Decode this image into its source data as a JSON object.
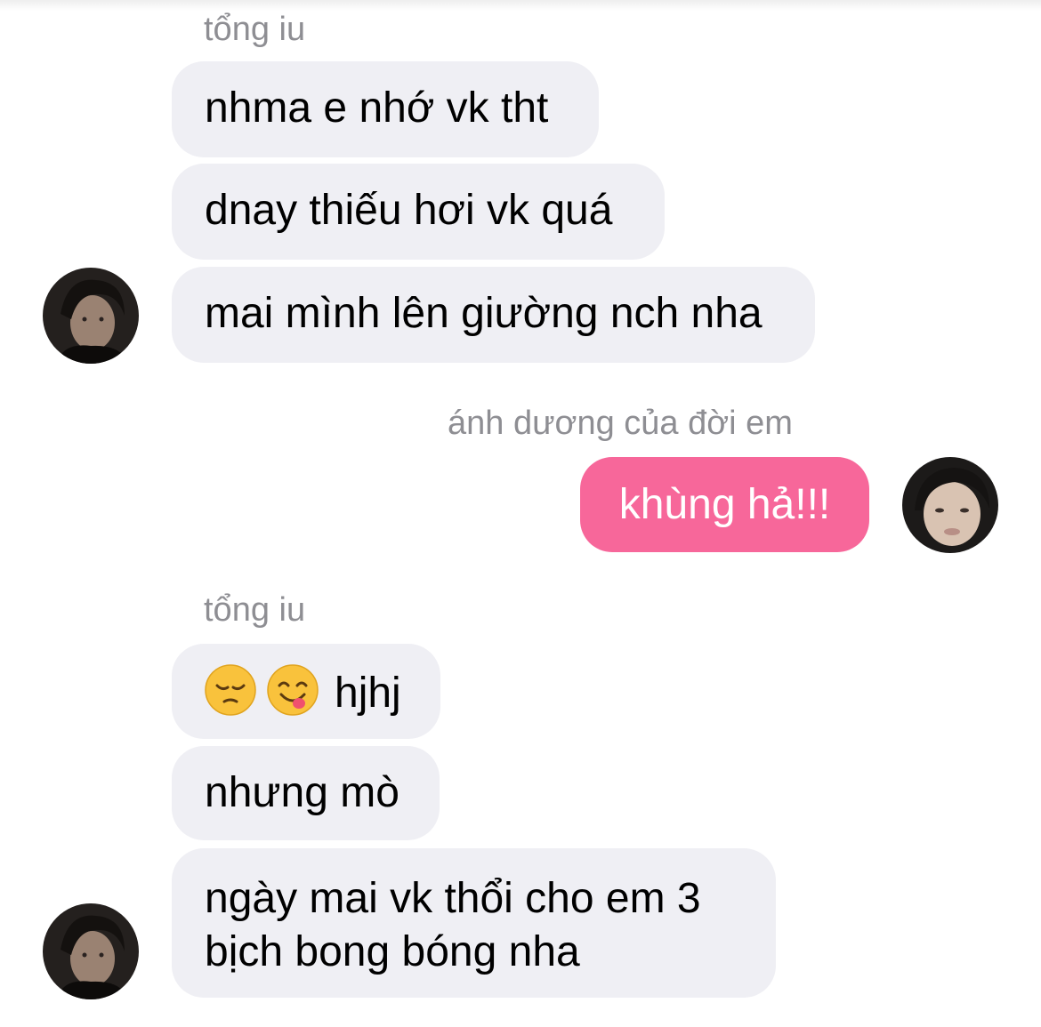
{
  "conversation": {
    "groups": [
      {
        "sender": "tổng iu",
        "messages": [
          "nhma e nhớ vk tht",
          "dnay thiếu hơi vk quá",
          "mai mình lên giường nch nha"
        ]
      },
      {
        "sender": "ánh dương của đời em",
        "messages": [
          "khùng hả!!!"
        ]
      },
      {
        "sender": "tổng iu",
        "messages": [
          {
            "emojis": [
              "pensive-face",
              "face-savoring-food"
            ],
            "text": "hjhj"
          },
          "nhưng mò",
          "ngày mai vk thổi cho em 3 bịch bong bóng nha"
        ]
      }
    ]
  },
  "colors": {
    "incoming_bubble": "#efeff4",
    "outgoing_bubble": "#f7679a",
    "sender_name": "#8e8e93"
  }
}
